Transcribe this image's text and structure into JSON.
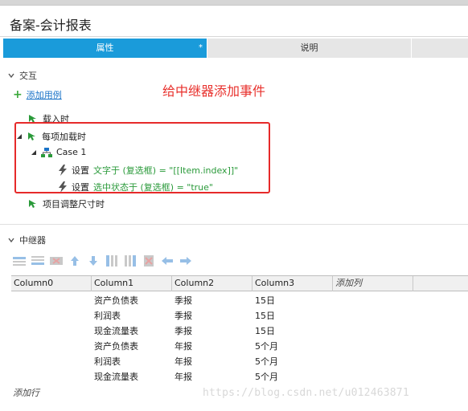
{
  "window": {
    "title": "备案-会计报表"
  },
  "tabs": [
    {
      "label": "属性",
      "marker": "*"
    },
    {
      "label": "说明"
    }
  ],
  "interaction_section": {
    "label": "交互",
    "add_use_case_link": "添加用例",
    "events": {
      "on_load": "载入时",
      "on_item_load": "每项加载时",
      "case1": "Case 1",
      "action1": {
        "verb": "设置",
        "detail": "文字于 (复选框) = \"[[Item.index]]\""
      },
      "action2": {
        "verb": "设置",
        "detail": "选中状态于 (复选框) = \"true\""
      },
      "on_item_resize": "项目调整尺寸时"
    }
  },
  "annotation": "给中继器添加事件",
  "repeater_section": {
    "label": "中继器",
    "columns": [
      "Column0",
      "Column1",
      "Column2",
      "Column3"
    ],
    "add_column": "添加列",
    "rows": [
      [
        "",
        "资产负债表",
        "季报",
        "15日"
      ],
      [
        "",
        "利润表",
        "季报",
        "15日"
      ],
      [
        "",
        "现金流量表",
        "季报",
        "15日"
      ],
      [
        "",
        "资产负债表",
        "年报",
        "5个月"
      ],
      [
        "",
        "利润表",
        "年报",
        "5个月"
      ],
      [
        "",
        "现金流量表",
        "年报",
        "5个月"
      ]
    ],
    "add_row": "添加行"
  },
  "watermark": "https://blog.csdn.net/u012463871",
  "colors": {
    "accent_tab": "#1a9bda",
    "annotation": "#e8302c",
    "link": "#1a73c8",
    "action_detail": "#2a9a3a"
  }
}
